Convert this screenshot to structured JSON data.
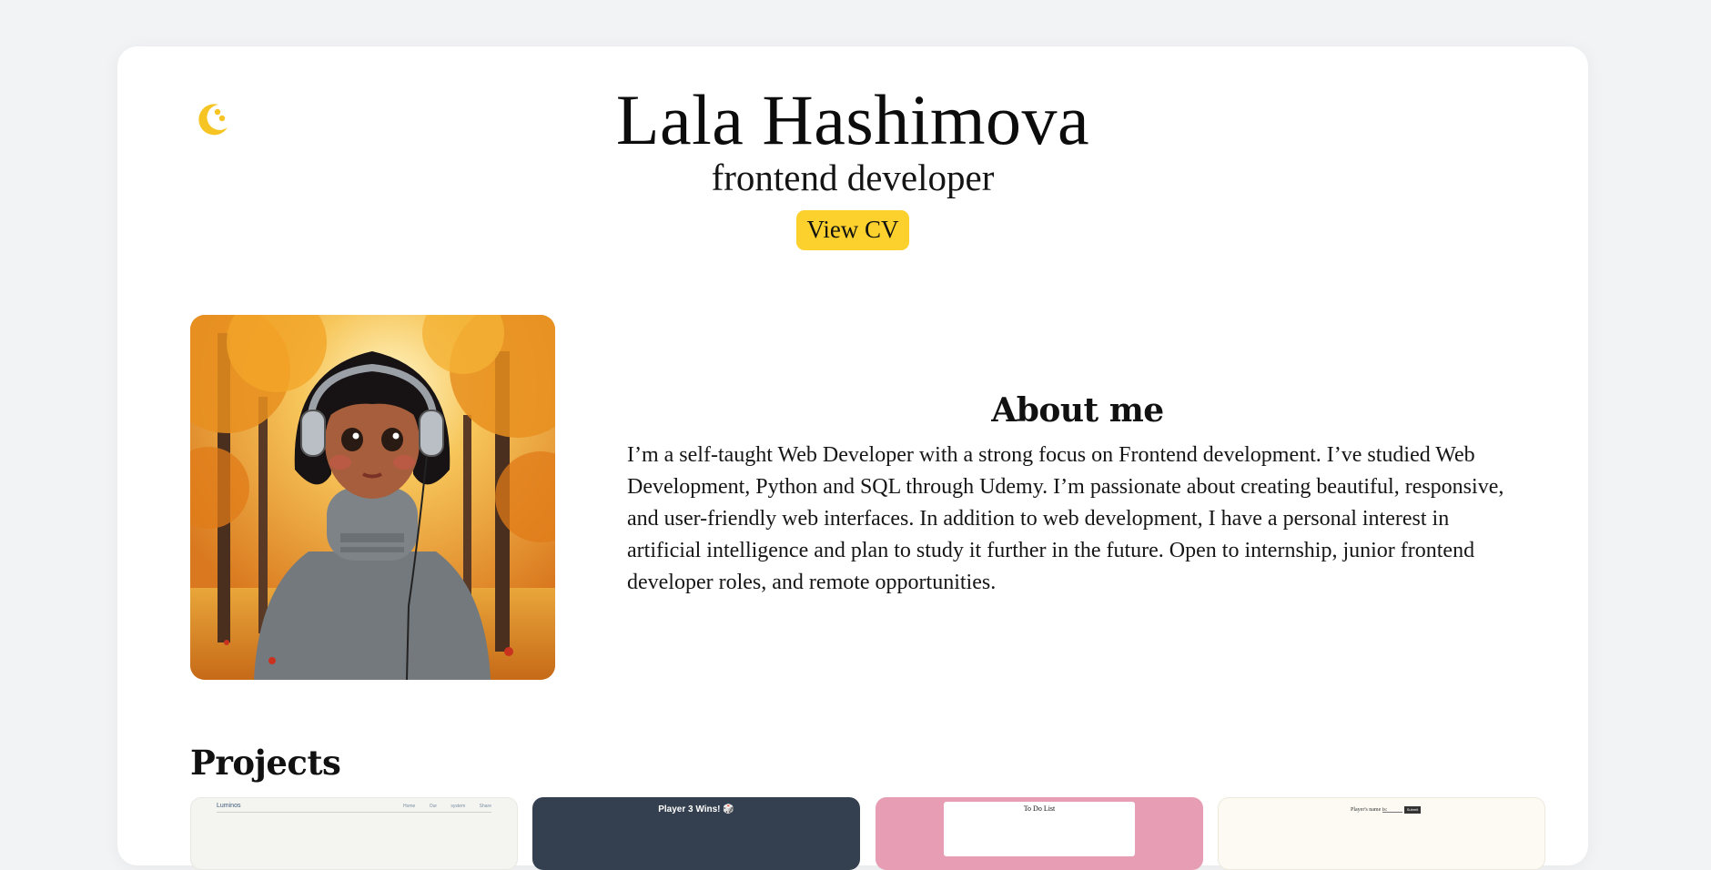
{
  "header": {
    "name": "Lala Hashimova",
    "role": "frontend developer",
    "cv_button_label": "View CV"
  },
  "theme_toggle": {
    "icon": "moon-icon",
    "color": "#f6c523"
  },
  "portrait": {
    "alt": "Illustrated avatar of a girl with headphones in an autumn park"
  },
  "about": {
    "heading": "About me",
    "text": "I’m a self-taught Web Developer with a strong focus on Frontend development. I’ve studied Web Development, Python and SQL through Udemy. I’m passionate about creating beautiful, responsive, and user-friendly web interfaces. In addition to web development, I have a personal interest in artificial intelligence and plan to study it further in the future. Open to internship, junior frontend developer roles, and remote opportunities."
  },
  "projects": {
    "heading": "Projects",
    "items": [
      {
        "preview_title": "Luminos",
        "preview_links": "Home Our system Share"
      },
      {
        "preview_title": "Player 3 Wins! 🎲"
      },
      {
        "preview_title": "To Do List"
      },
      {
        "preview_title": "Player's name is:",
        "preview_button": "Submit"
      }
    ]
  },
  "colors": {
    "accent": "#fdd12d",
    "page_bg": "#f2f3f5",
    "card_bg": "#ffffff"
  }
}
